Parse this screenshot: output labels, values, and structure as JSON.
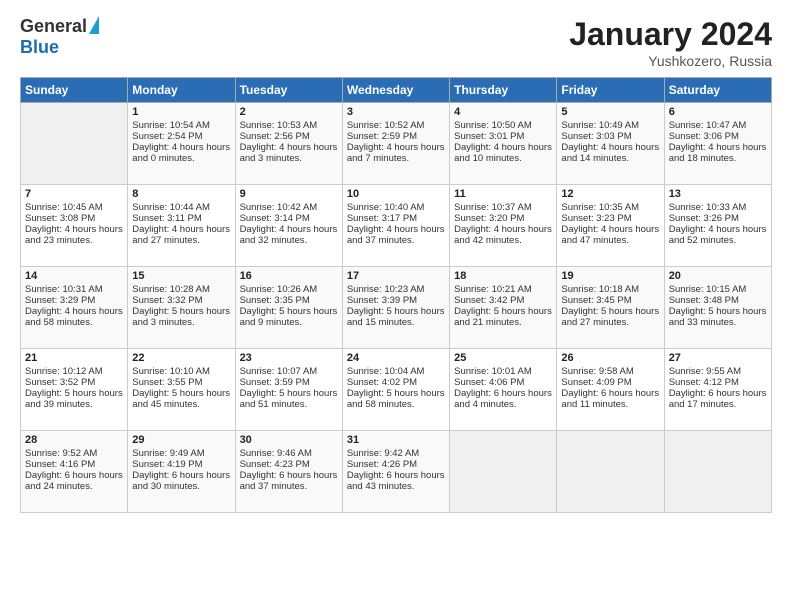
{
  "header": {
    "logo_general": "General",
    "logo_blue": "Blue",
    "title": "January 2024",
    "location": "Yushkozero, Russia"
  },
  "weekdays": [
    "Sunday",
    "Monday",
    "Tuesday",
    "Wednesday",
    "Thursday",
    "Friday",
    "Saturday"
  ],
  "rows": [
    [
      {
        "day": "",
        "empty": true
      },
      {
        "day": "1",
        "sunrise": "10:54 AM",
        "sunset": "2:54 PM",
        "daylight": "4 hours and 0 minutes."
      },
      {
        "day": "2",
        "sunrise": "10:53 AM",
        "sunset": "2:56 PM",
        "daylight": "4 hours and 3 minutes."
      },
      {
        "day": "3",
        "sunrise": "10:52 AM",
        "sunset": "2:59 PM",
        "daylight": "4 hours and 7 minutes."
      },
      {
        "day": "4",
        "sunrise": "10:50 AM",
        "sunset": "3:01 PM",
        "daylight": "4 hours and 10 minutes."
      },
      {
        "day": "5",
        "sunrise": "10:49 AM",
        "sunset": "3:03 PM",
        "daylight": "4 hours and 14 minutes."
      },
      {
        "day": "6",
        "sunrise": "10:47 AM",
        "sunset": "3:06 PM",
        "daylight": "4 hours and 18 minutes."
      }
    ],
    [
      {
        "day": "7",
        "sunrise": "10:45 AM",
        "sunset": "3:08 PM",
        "daylight": "4 hours and 23 minutes."
      },
      {
        "day": "8",
        "sunrise": "10:44 AM",
        "sunset": "3:11 PM",
        "daylight": "4 hours and 27 minutes."
      },
      {
        "day": "9",
        "sunrise": "10:42 AM",
        "sunset": "3:14 PM",
        "daylight": "4 hours and 32 minutes."
      },
      {
        "day": "10",
        "sunrise": "10:40 AM",
        "sunset": "3:17 PM",
        "daylight": "4 hours and 37 minutes."
      },
      {
        "day": "11",
        "sunrise": "10:37 AM",
        "sunset": "3:20 PM",
        "daylight": "4 hours and 42 minutes."
      },
      {
        "day": "12",
        "sunrise": "10:35 AM",
        "sunset": "3:23 PM",
        "daylight": "4 hours and 47 minutes."
      },
      {
        "day": "13",
        "sunrise": "10:33 AM",
        "sunset": "3:26 PM",
        "daylight": "4 hours and 52 minutes."
      }
    ],
    [
      {
        "day": "14",
        "sunrise": "10:31 AM",
        "sunset": "3:29 PM",
        "daylight": "4 hours and 58 minutes."
      },
      {
        "day": "15",
        "sunrise": "10:28 AM",
        "sunset": "3:32 PM",
        "daylight": "5 hours and 3 minutes."
      },
      {
        "day": "16",
        "sunrise": "10:26 AM",
        "sunset": "3:35 PM",
        "daylight": "5 hours and 9 minutes."
      },
      {
        "day": "17",
        "sunrise": "10:23 AM",
        "sunset": "3:39 PM",
        "daylight": "5 hours and 15 minutes."
      },
      {
        "day": "18",
        "sunrise": "10:21 AM",
        "sunset": "3:42 PM",
        "daylight": "5 hours and 21 minutes."
      },
      {
        "day": "19",
        "sunrise": "10:18 AM",
        "sunset": "3:45 PM",
        "daylight": "5 hours and 27 minutes."
      },
      {
        "day": "20",
        "sunrise": "10:15 AM",
        "sunset": "3:48 PM",
        "daylight": "5 hours and 33 minutes."
      }
    ],
    [
      {
        "day": "21",
        "sunrise": "10:12 AM",
        "sunset": "3:52 PM",
        "daylight": "5 hours and 39 minutes."
      },
      {
        "day": "22",
        "sunrise": "10:10 AM",
        "sunset": "3:55 PM",
        "daylight": "5 hours and 45 minutes."
      },
      {
        "day": "23",
        "sunrise": "10:07 AM",
        "sunset": "3:59 PM",
        "daylight": "5 hours and 51 minutes."
      },
      {
        "day": "24",
        "sunrise": "10:04 AM",
        "sunset": "4:02 PM",
        "daylight": "5 hours and 58 minutes."
      },
      {
        "day": "25",
        "sunrise": "10:01 AM",
        "sunset": "4:06 PM",
        "daylight": "6 hours and 4 minutes."
      },
      {
        "day": "26",
        "sunrise": "9:58 AM",
        "sunset": "4:09 PM",
        "daylight": "6 hours and 11 minutes."
      },
      {
        "day": "27",
        "sunrise": "9:55 AM",
        "sunset": "4:12 PM",
        "daylight": "6 hours and 17 minutes."
      }
    ],
    [
      {
        "day": "28",
        "sunrise": "9:52 AM",
        "sunset": "4:16 PM",
        "daylight": "6 hours and 24 minutes."
      },
      {
        "day": "29",
        "sunrise": "9:49 AM",
        "sunset": "4:19 PM",
        "daylight": "6 hours and 30 minutes."
      },
      {
        "day": "30",
        "sunrise": "9:46 AM",
        "sunset": "4:23 PM",
        "daylight": "6 hours and 37 minutes."
      },
      {
        "day": "31",
        "sunrise": "9:42 AM",
        "sunset": "4:26 PM",
        "daylight": "6 hours and 43 minutes."
      },
      {
        "day": "",
        "empty": true
      },
      {
        "day": "",
        "empty": true
      },
      {
        "day": "",
        "empty": true
      }
    ]
  ],
  "labels": {
    "sunrise_prefix": "Sunrise: ",
    "sunset_prefix": "Sunset: ",
    "daylight_prefix": "Daylight: "
  }
}
